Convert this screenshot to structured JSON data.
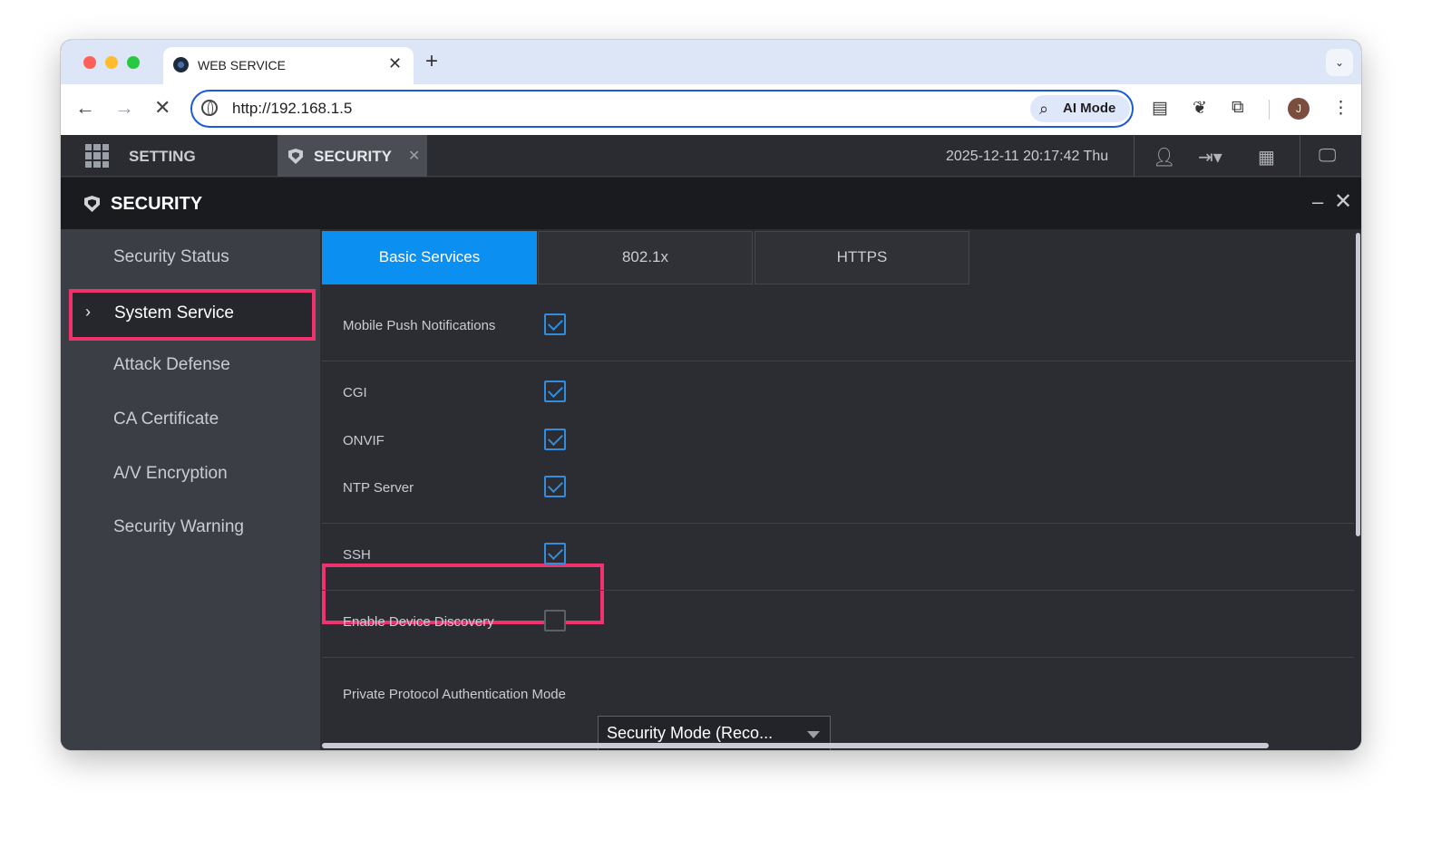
{
  "browser": {
    "tab_title": "WEB SERVICE",
    "url": "http://192.168.1.5",
    "ai_mode_label": "AI Mode",
    "avatar_initial": "J"
  },
  "app": {
    "menu_label": "SETTING",
    "open_tab_label": "SECURITY",
    "datetime": "2025-12-11 20:17:42 Thu"
  },
  "panel": {
    "title": "SECURITY"
  },
  "sidebar": {
    "items": [
      {
        "label": "Security Status"
      },
      {
        "label": "System Service",
        "active": true
      },
      {
        "label": "Attack Defense"
      },
      {
        "label": "CA Certificate"
      },
      {
        "label": "A/V Encryption"
      },
      {
        "label": "Security Warning"
      }
    ]
  },
  "tabs": [
    {
      "label": "Basic Services",
      "active": true
    },
    {
      "label": "802.1x"
    },
    {
      "label": "HTTPS"
    }
  ],
  "services": [
    {
      "label": "Mobile Push Notifications",
      "checked": true
    },
    {
      "label": "CGI",
      "checked": true
    },
    {
      "label": "ONVIF",
      "checked": true
    },
    {
      "label": "NTP Server",
      "checked": true
    },
    {
      "label": "SSH",
      "checked": true,
      "highlighted": true
    },
    {
      "label": "Enable Device Discovery",
      "checked": false
    }
  ],
  "auth_mode": {
    "label": "Private Protocol Authentication Mode",
    "value": "Security Mode (Reco..."
  },
  "colors": {
    "accent": "#0b8ff0",
    "highlight": "#f0336f"
  }
}
